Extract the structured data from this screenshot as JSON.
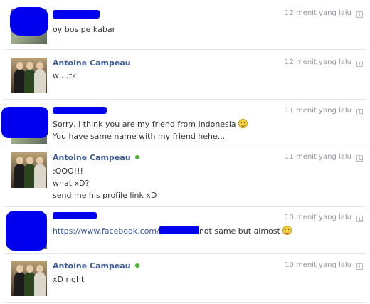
{
  "conversation": {
    "messages": [
      {
        "sender": "",
        "time": "12 menit yang lalu",
        "lines": [
          "oy bos pe kabar"
        ]
      },
      {
        "sender": "Antoine Campeau",
        "time": "12 menit yang lalu",
        "lines": [
          "wuut?"
        ]
      },
      {
        "sender": "",
        "time": "11 menit yang lalu",
        "lines": [
          "Sorry, I think you are my friend from Indonesia",
          "You have same name with my friend hehe..."
        ]
      },
      {
        "sender": "Antoine Campeau",
        "time": "11 menit yang lalu",
        "lines": [
          ":OOO!!!",
          "what xD?",
          "send me his profile link xD"
        ]
      },
      {
        "sender": "",
        "time": "10 menit yang lalu",
        "link": "https://www.facebook.com/",
        "text_after": "not same but almost"
      },
      {
        "sender": "Antoine Campeau",
        "time": "10 menit yang lalu",
        "lines": [
          "xD right"
        ]
      }
    ]
  },
  "colors": {
    "name": "#3b5998",
    "timestamp": "#9197a3",
    "redaction": "#0000ee",
    "online": "#42b72a"
  }
}
